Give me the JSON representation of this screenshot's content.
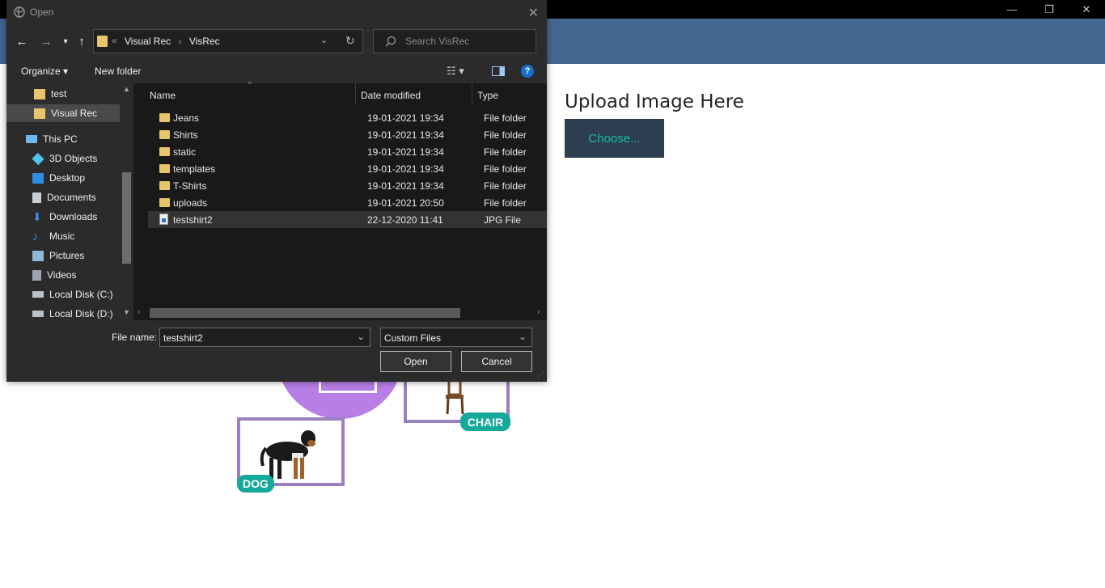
{
  "app": {
    "window_controls": [
      "—",
      "❐",
      "✕"
    ],
    "upload_title": "Upload Image Here",
    "choose_label": "Choose..."
  },
  "illustration": {
    "tags": [
      "CHAIR",
      "DOG"
    ]
  },
  "dialog": {
    "title": "Open",
    "breadcrumb": [
      "«",
      "Visual Rec",
      "›",
      "VisRec"
    ],
    "search_placeholder": "Search VisRec",
    "toolbar": {
      "organize": "Organize ▾",
      "new_folder": "New folder"
    },
    "nav_items": [
      {
        "label": "test",
        "icon": "folder-icon"
      },
      {
        "label": "Visual Rec",
        "icon": "folder-icon",
        "selected": true
      },
      {
        "label": "This PC",
        "icon": "pc-icon"
      },
      {
        "label": "3D Objects",
        "icon": "cube-icon"
      },
      {
        "label": "Desktop",
        "icon": "desktop-icon"
      },
      {
        "label": "Documents",
        "icon": "documents-icon"
      },
      {
        "label": "Downloads",
        "icon": "download-icon"
      },
      {
        "label": "Music",
        "icon": "music-icon"
      },
      {
        "label": "Pictures",
        "icon": "pictures-icon"
      },
      {
        "label": "Videos",
        "icon": "videos-icon"
      },
      {
        "label": "Local Disk (C:)",
        "icon": "disk-icon"
      },
      {
        "label": "Local Disk (D:)",
        "icon": "disk-icon"
      }
    ],
    "columns": [
      "Name",
      "Date modified",
      "Type"
    ],
    "files": [
      {
        "name": "Jeans",
        "date": "19-01-2021 19:34",
        "type": "File folder",
        "icon": "folder-icon"
      },
      {
        "name": "Shirts",
        "date": "19-01-2021 19:34",
        "type": "File folder",
        "icon": "folder-icon"
      },
      {
        "name": "static",
        "date": "19-01-2021 19:34",
        "type": "File folder",
        "icon": "folder-icon"
      },
      {
        "name": "templates",
        "date": "19-01-2021 19:34",
        "type": "File folder",
        "icon": "folder-icon"
      },
      {
        "name": "T-Shirts",
        "date": "19-01-2021 19:34",
        "type": "File folder",
        "icon": "folder-icon"
      },
      {
        "name": "uploads",
        "date": "19-01-2021 20:50",
        "type": "File folder",
        "icon": "folder-icon"
      },
      {
        "name": "testshirt2",
        "date": "22-12-2020 11:41",
        "type": "JPG File",
        "icon": "image-file-icon",
        "selected": true
      }
    ],
    "file_name_label": "File name:",
    "file_name_value": "testshirt2",
    "filter_value": "Custom Files",
    "open_label": "Open",
    "cancel_label": "Cancel"
  },
  "colors": {
    "header": "#436890",
    "choose_bg": "#2c3e50",
    "choose_text": "#18bc9c",
    "folder": "#e8c46a",
    "tag": "#14a99a"
  }
}
